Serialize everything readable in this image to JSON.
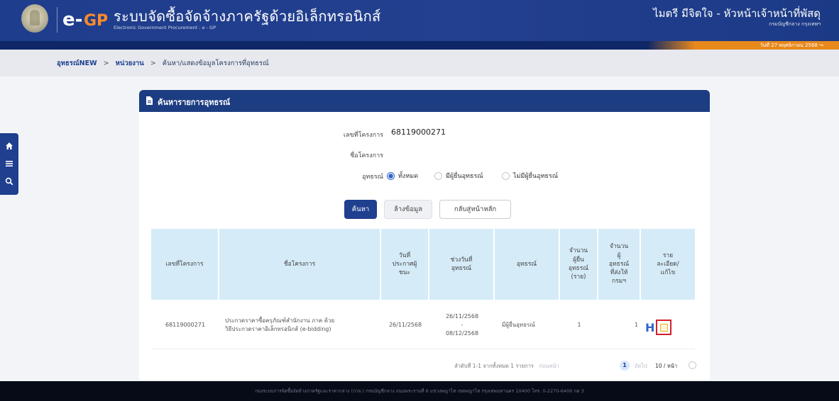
{
  "header": {
    "system_title": "ระบบจัดซื้อจัดจ้างภาครัฐด้วยอิเล็กทรอนิกส์",
    "system_subtitle": "Electronic Government Procurement : e - GP",
    "logo_text": "e-GP",
    "user_name": "ไมตรี มีจิตใจ - หัวหน้าเจ้าหน้าที่พัสดุ",
    "user_dept": "กรมบัญชีกลาง กรุงเทพฯ",
    "date_text": "วันที่ 27 พฤศจิกายน 2568",
    "brand_color": "#1e3d8c",
    "accent_color": "#e8891c"
  },
  "breadcrumb": {
    "items": [
      "อุทธรณ์NEW",
      "หน่วยงาน",
      "ค้นหา/แสดงข้อมูลโครงการที่อุทธรณ์"
    ],
    "separator": ">"
  },
  "left_dock": {
    "icons": [
      "home-icon",
      "menu-icon",
      "search-icon"
    ]
  },
  "panel": {
    "title": "ค้นหารายการอุทธรณ์",
    "title_icon": "document-icon"
  },
  "form": {
    "project_no_label": "เลขที่โครงการ",
    "project_no_value": "68119000271",
    "project_name_label": "ชื่อโครงการ",
    "project_name_value": "",
    "appeal_label": "อุทธรณ์",
    "appeal_options": [
      "ทั้งหมด",
      "มีผู้ยื่นอุทธรณ์",
      "ไม่มีผู้ยื่นอุทธรณ์"
    ],
    "appeal_selected": "ทั้งหมด"
  },
  "buttons": {
    "search": "ค้นหา",
    "clear": "ล้างข้อมูล",
    "back_home": "กลับสู่หน้าหลัก"
  },
  "table": {
    "headers": [
      "เลขที่โครงการ",
      "ชื่อโครงการ",
      "วันที่\nประกาศผู้\nชนะ",
      "ช่วงวันที่\nอุทธรณ์",
      "อุทธรณ์",
      "จำนวน\nผู้ยื่น\nอุทธรณ์\n(ราย)",
      "จำนวน\nผู้\nอุทธรณ์\nที่ส่งให้\nกรมฯ",
      "ราย\nละเอียด/\nแก้ไข"
    ],
    "rows": [
      {
        "project_no": "68119000271",
        "project_name": "ประกวดราคาซื้อครุภัณฑ์สำนักงาน ภาค ด้วย\nวิธีประกวดราคาอิเล็กทรอนิกส์ (e-bidding)",
        "announce_date": "26/11/2568",
        "appeal_period": "26/11/2568\n-\n08/12/2568",
        "appeal_status": "มีผู้ยื่นอุทธรณ์",
        "appellant_count": "1",
        "forwarded_count": "1",
        "actions": [
          "history-icon",
          "edit-document-icon"
        ]
      }
    ]
  },
  "pagination": {
    "info": "ลำดับที่ 1-1 จากทั้งหมด 1 รายการ",
    "prev": "ก่อนหน้า",
    "current_page": "1",
    "next": "ถัดไป",
    "page_size": "10 / หน้า"
  },
  "footer": {
    "text": "กองระบบการจัดซื้อจัดจ้างภาครัฐและราคากลาง (กวจ.) กรมบัญชีกลาง ถนนพระรามที่ 6 แขวงพญาไท เขตพญาไท กรุงเทพมหานคร 10400 โทร. 0-2270-6400 กด 3"
  }
}
